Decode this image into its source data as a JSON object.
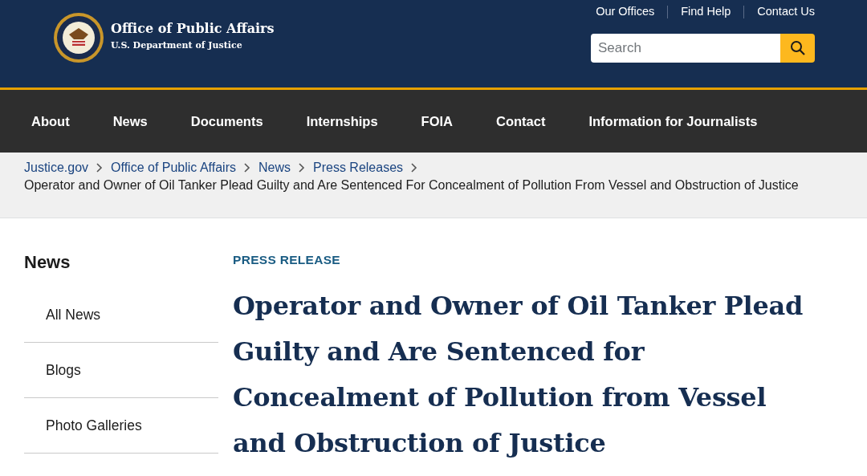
{
  "header": {
    "title": "Office of Public Affairs",
    "subtitle": "U.S. Department of Justice",
    "utility_links": [
      "Our Offices",
      "Find Help",
      "Contact Us"
    ],
    "search": {
      "placeholder": "Search"
    }
  },
  "nav": [
    "About",
    "News",
    "Documents",
    "Internships",
    "FOIA",
    "Contact",
    "Information for Journalists"
  ],
  "breadcrumb": {
    "links": [
      "Justice.gov",
      "Office of Public Affairs",
      "News",
      "Press Releases"
    ],
    "current": "Operator and Owner of Oil Tanker Plead Guilty and Are Sentenced For Concealment of Pollution From Vessel and Obstruction of Justice"
  },
  "sidebar": {
    "title": "News",
    "items": [
      "All News",
      "Blogs",
      "Photo Galleries"
    ]
  },
  "article": {
    "label": "PRESS RELEASE",
    "title": "Operator and Owner of Oil Tanker Plead Guilty and Are Sentenced for Concealment of Pollution from Vessel and Obstruction of Justice"
  }
}
